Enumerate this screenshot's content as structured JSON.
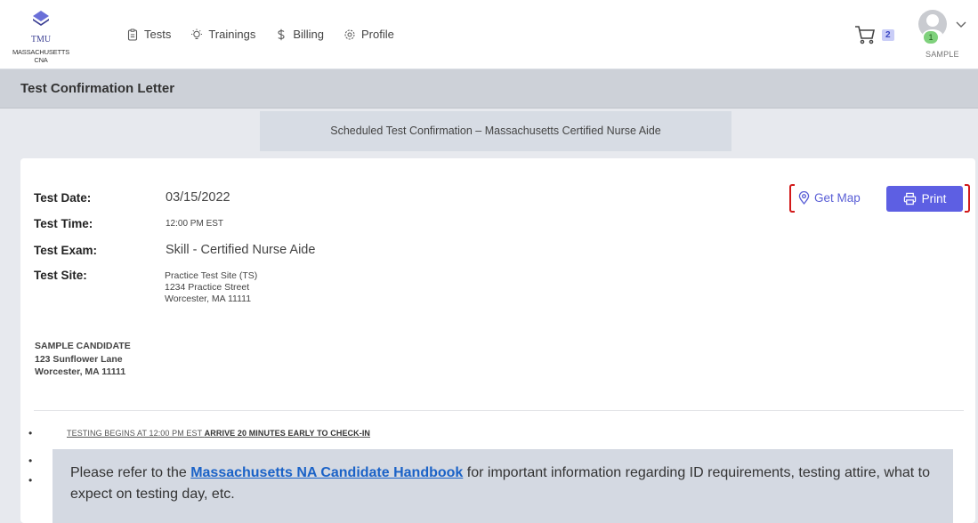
{
  "header": {
    "logo_text": "TMU",
    "logo_subtext": "MASSACHUSETTS CNA",
    "nav": [
      {
        "label": "Tests",
        "icon": "clipboard-icon"
      },
      {
        "label": "Trainings",
        "icon": "lightbulb-icon"
      },
      {
        "label": "Billing",
        "icon": "dollar-icon"
      },
      {
        "label": "Profile",
        "icon": "gear-icon"
      }
    ],
    "cart_count": "2",
    "notification_count": "1",
    "user_label": "SAMPLE"
  },
  "page": {
    "title": "Test Confirmation Letter",
    "subheader": "Scheduled Test Confirmation – Massachusetts Certified Nurse Aide"
  },
  "details": {
    "date_label": "Test Date:",
    "date_value": "03/15/2022",
    "time_label": "Test Time:",
    "time_value": "12:00 PM EST",
    "exam_label": "Test Exam:",
    "exam_value": "Skill - Certified Nurse Aide",
    "site_label": "Test Site:",
    "site_lines": [
      "Practice Test Site (TS)",
      "1234 Practice Street",
      "Worcester, MA 11111"
    ]
  },
  "actions": {
    "map_label": "Get Map",
    "print_label": "Print"
  },
  "candidate": {
    "name": "SAMPLE CANDIDATE",
    "street": "123 Sunflower Lane",
    "city": "Worcester, MA 11111"
  },
  "notices": {
    "testing_begins": "TESTING BEGINS AT 12:00 PM EST",
    "arrive_early": "ARRIVE 20 MINUTES EARLY TO CHECK-IN",
    "handbook_prefix": "Please refer to the ",
    "handbook_link": "Massachusetts NA Candidate Handbook",
    "handbook_suffix": " for important information regarding ID requirements, testing attire, what to expect on testing day, etc."
  },
  "colors": {
    "accent": "#5d5fe3",
    "header_bar": "#cdd1d8",
    "highlight_bracket": "#d21a1a",
    "link": "#1a62c7"
  }
}
